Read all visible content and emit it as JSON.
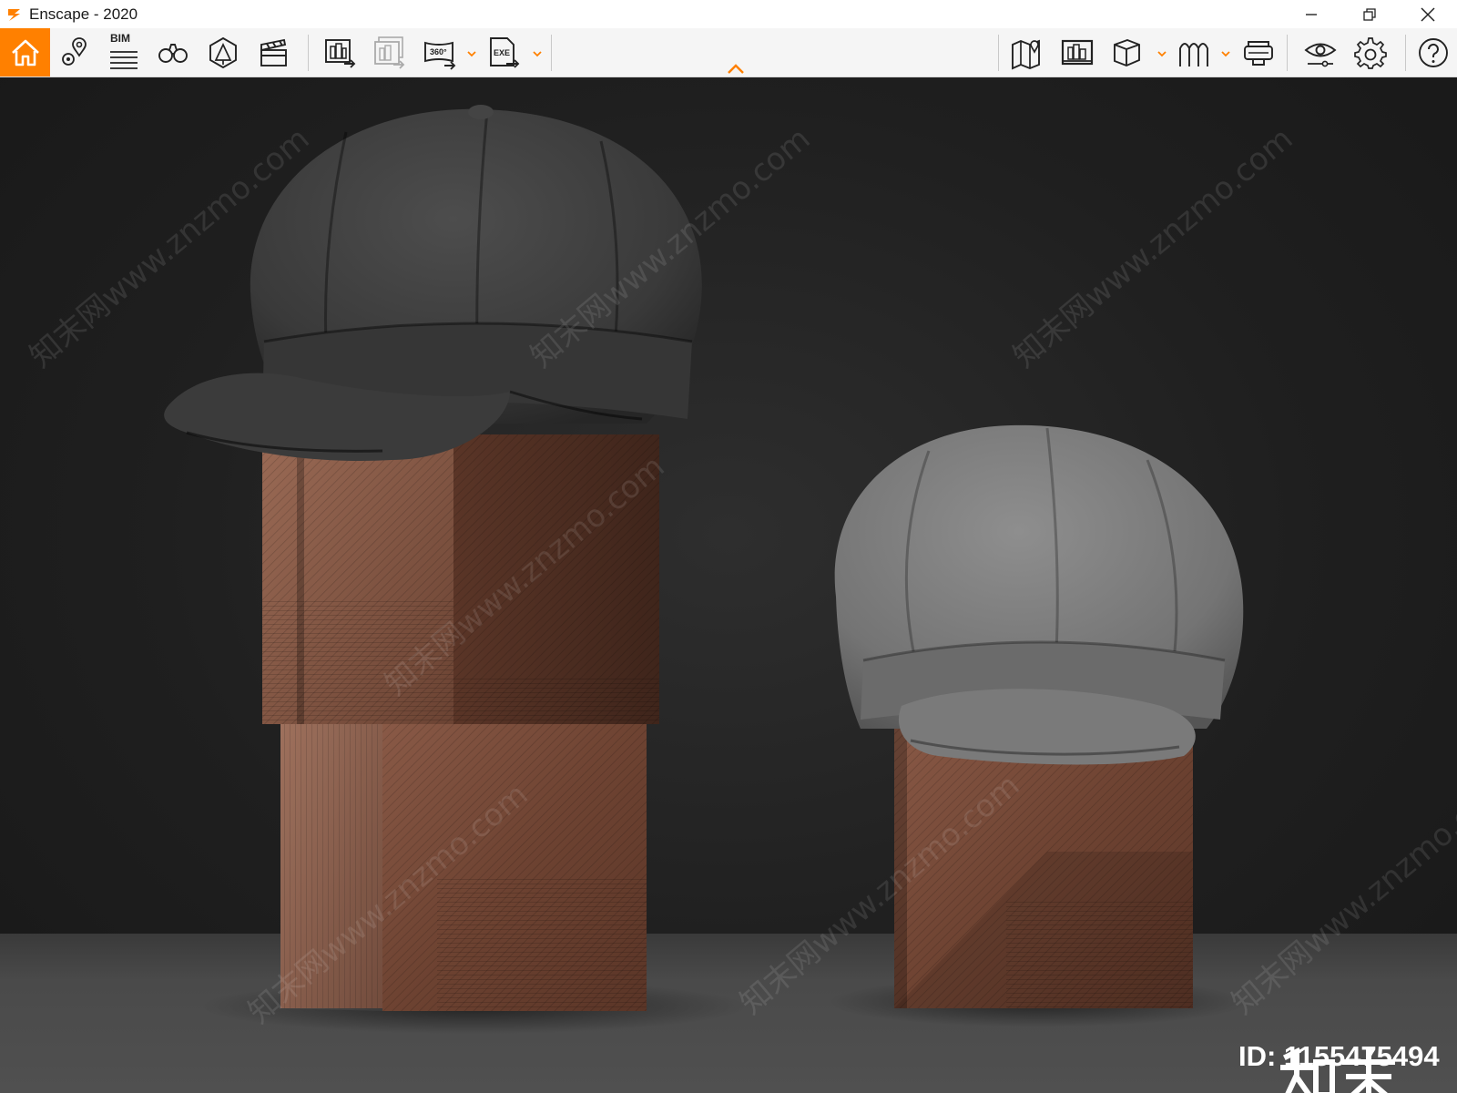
{
  "window": {
    "title": "Enscape - 2020",
    "controls": [
      "minimize-icon",
      "restore-icon",
      "close-icon"
    ]
  },
  "toolbar": {
    "accent": "#ff8000",
    "bim_label": "BIM",
    "left_tools": [
      {
        "name": "home",
        "icon": "home-icon",
        "active": true
      },
      {
        "name": "views",
        "icon": "location-pin-icon"
      },
      {
        "name": "bim-info",
        "icon": "bim-list-icon"
      },
      {
        "name": "walk-mode",
        "icon": "binoculars-icon"
      },
      {
        "name": "asset-library",
        "icon": "asset-icon"
      },
      {
        "name": "video-editor",
        "icon": "clapperboard-icon"
      },
      {
        "name": "render-image",
        "icon": "render-image-icon"
      },
      {
        "name": "batch-render",
        "icon": "batch-render-icon"
      },
      {
        "name": "panorama",
        "icon": "panorama-360-icon",
        "label": "360°"
      },
      {
        "name": "export-exe",
        "icon": "export-exe-icon",
        "label": "EXE"
      }
    ],
    "right_tools": [
      {
        "name": "map",
        "icon": "map-icon"
      },
      {
        "name": "screenshot-gallery",
        "icon": "gallery-icon"
      },
      {
        "name": "orthographic-view",
        "icon": "cube-icon"
      },
      {
        "name": "collaboration",
        "icon": "collaboration-icon"
      },
      {
        "name": "vr-headset",
        "icon": "vr-headset-icon"
      },
      {
        "name": "visual-settings",
        "icon": "eye-settings-icon"
      },
      {
        "name": "general-settings",
        "icon": "gear-icon"
      },
      {
        "name": "help",
        "icon": "help-icon"
      }
    ]
  },
  "viewport": {
    "watermark_text": "知末网www.znzmo.com",
    "brand_text": "知末",
    "id_label": "ID: 1155475494"
  }
}
